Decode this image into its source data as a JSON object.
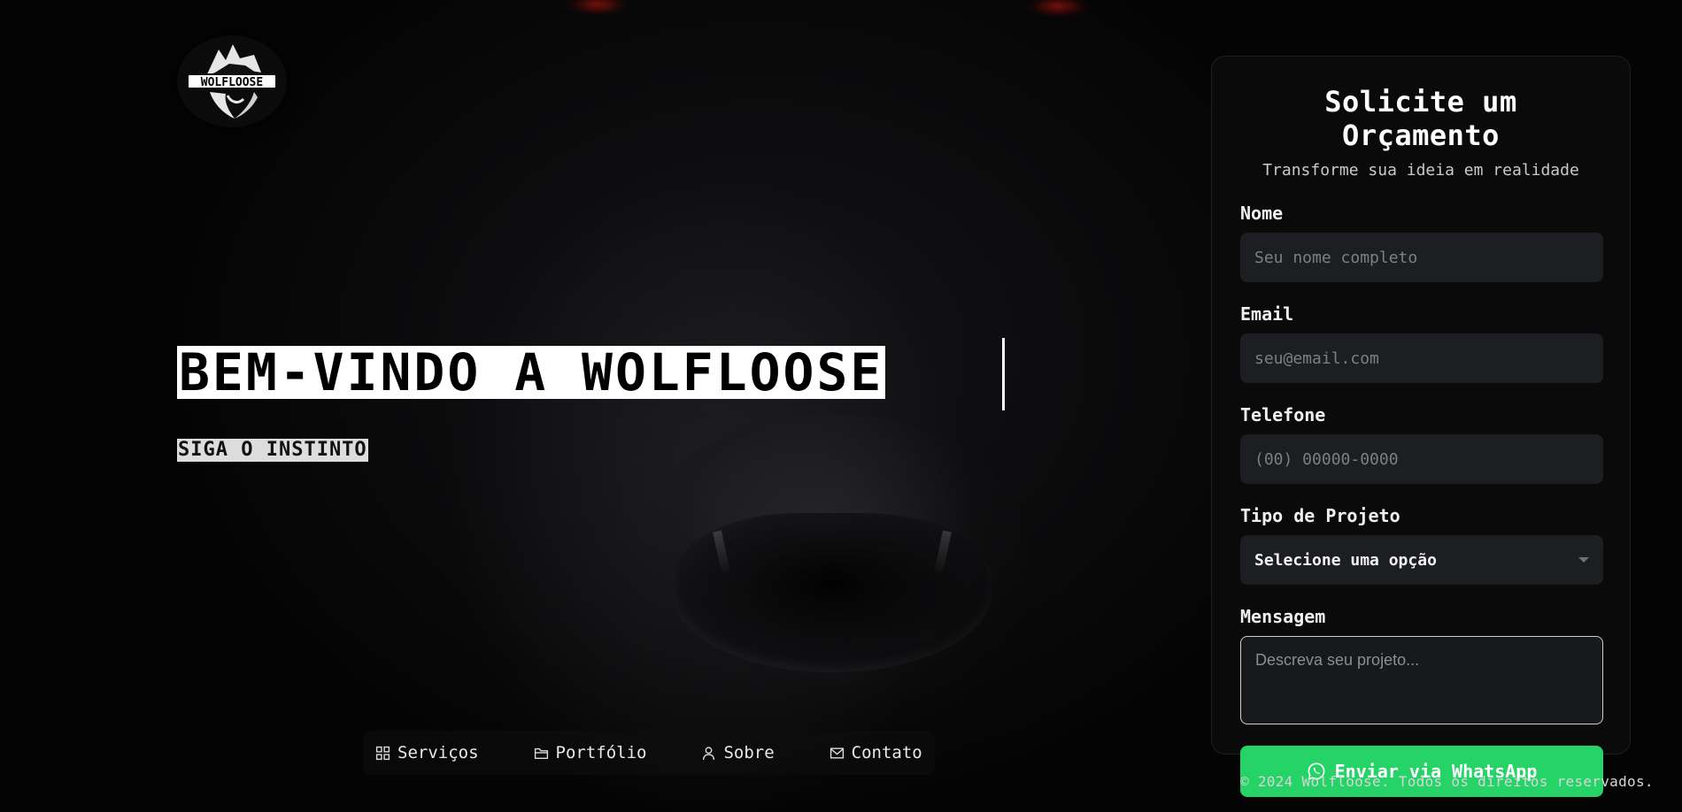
{
  "brand": {
    "logo_text": "WOLFLOOSE",
    "logo_icon": "wolf-head-icon"
  },
  "hero": {
    "title": "BEM-VINDO A WOLFLOOSE",
    "tagline": "SIGA O INSTINTO"
  },
  "nav": {
    "items": [
      {
        "label": "Serviços",
        "icon": "grid-icon"
      },
      {
        "label": "Portfólio",
        "icon": "folder-icon"
      },
      {
        "label": "Sobre",
        "icon": "user-icon"
      },
      {
        "label": "Contato",
        "icon": "mail-icon"
      }
    ]
  },
  "form": {
    "title": "Solicite um Orçamento",
    "subtitle": "Transforme sua ideia em realidade",
    "name_label": "Nome",
    "name_placeholder": "Seu nome completo",
    "email_label": "Email",
    "email_placeholder": "seu@email.com",
    "phone_label": "Telefone",
    "phone_placeholder": "(00) 00000-0000",
    "project_label": "Tipo de Projeto",
    "project_selected": "Selecione uma opção",
    "message_label": "Mensagem",
    "message_placeholder": "Descreva seu projeto...",
    "submit_label": "Enviar via WhatsApp",
    "submit_icon": "whatsapp-icon"
  },
  "footer": {
    "copyright": "© 2024 Wolfloose. Todos os direitos reservados."
  },
  "colors": {
    "accent": "#25d366",
    "background": "#050505",
    "panel": "#0b0b0b",
    "input": "#1c1e21"
  }
}
